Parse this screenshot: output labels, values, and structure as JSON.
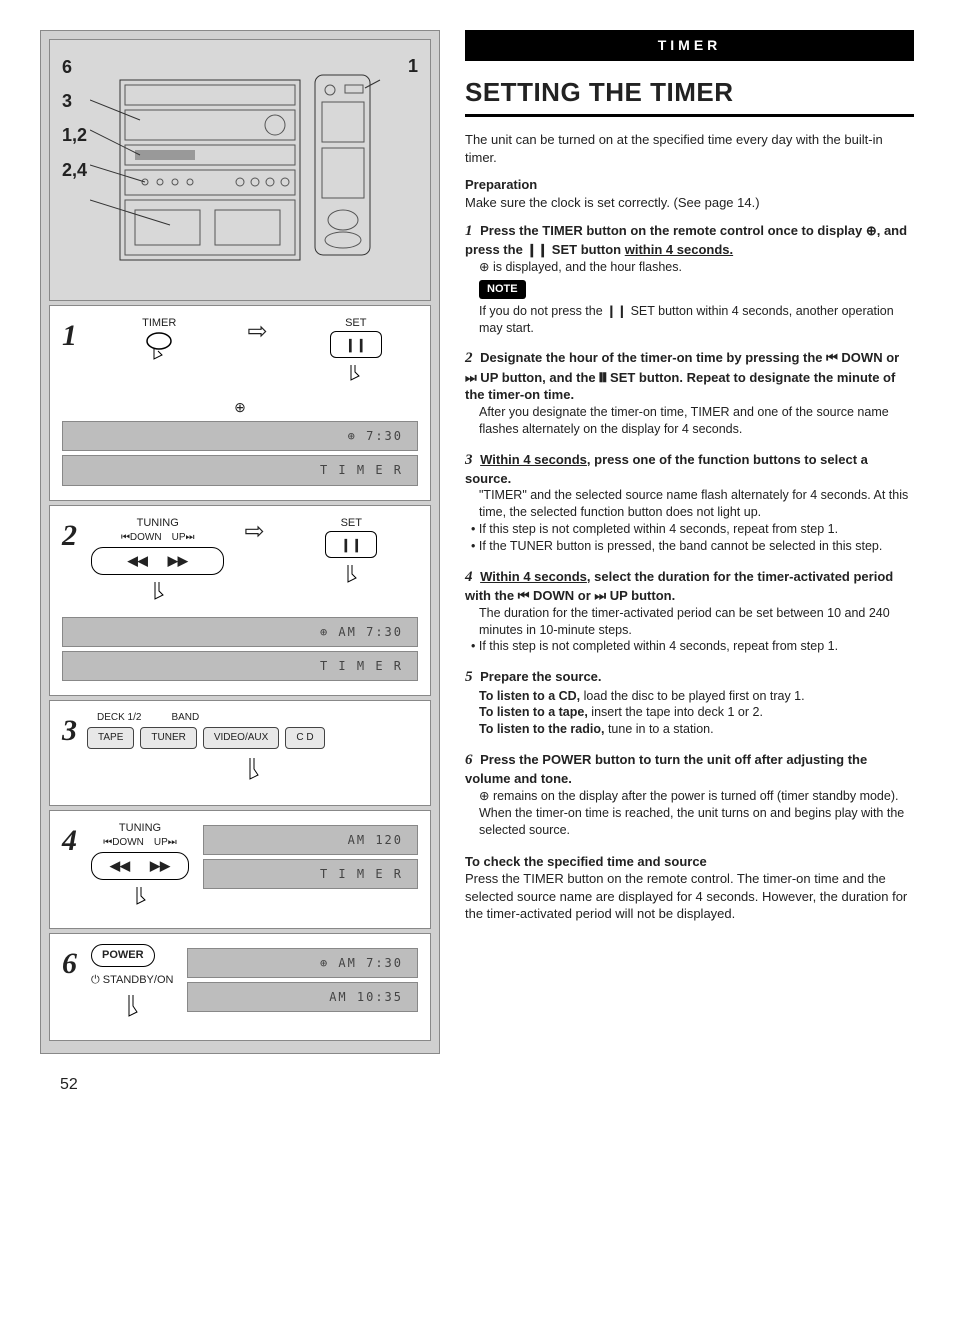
{
  "header": "TIMER",
  "title": "SETTING THE TIMER",
  "intro": "The unit can be turned on at the specified time every day with the built-in timer.",
  "prep_heading": "Preparation",
  "prep_text": "Make sure the clock is set correctly. (See page 14.)",
  "diagram_callouts": [
    "6",
    "3",
    "1,2",
    "2,4",
    "1"
  ],
  "steps_right": [
    {
      "num": "1",
      "bold": "Press the TIMER button on the remote control once to display ⊕, and press the ❙❙ SET button ",
      "bold_uline": "within 4 seconds.",
      "after": "⊕ is displayed, and the hour flashes.",
      "note_label": "NOTE",
      "note": "If you do not press the ❙❙ SET button within 4 seconds, another operation may start."
    },
    {
      "num": "2",
      "bold": "Designate the hour of the timer-on time by pressing the ⏮ DOWN or ⏭ UP button, and the ❙❙ SET button. Repeat to designate the minute of the timer-on time.",
      "after": "After you designate the timer-on time, TIMER and one of the source name flashes alternately on the display for 4 seconds."
    },
    {
      "num": "3",
      "bold_uline_lead": "Within 4 seconds",
      "bold_tail": ", press one of the function buttons to select a source.",
      "after": "\"TIMER\" and the selected source name flash alternately for 4 seconds. At this time, the selected function button does not light up.",
      "bullets": [
        "If this step is not completed within 4 seconds, repeat from step 1.",
        "If the TUNER button is pressed, the band cannot be selected in this step."
      ]
    },
    {
      "num": "4",
      "bold_uline_lead": "Within 4 seconds",
      "bold_tail": ", select the duration for the timer-activated period with the ⏮ DOWN or ⏭ UP button.",
      "after": "The duration for the timer-activated period can be set between 10 and 240 minutes in 10-minute steps.",
      "bullets": [
        "If this step is not completed within 4 seconds, repeat from step 1."
      ]
    },
    {
      "num": "5",
      "bold": "Prepare the source.",
      "lines": [
        {
          "b": "To listen to a CD,",
          "t": " load the disc to be played first on tray 1."
        },
        {
          "b": "To listen to a tape,",
          "t": " insert the tape into deck 1 or 2."
        },
        {
          "b": "To listen to the radio,",
          "t": " tune in to a station."
        }
      ]
    },
    {
      "num": "6",
      "bold": "Press the POWER button to turn the unit off after adjusting the volume and tone.",
      "after": "⊕ remains on the display after the power is turned off (timer standby mode).",
      "after2": "When the timer-on time is reached, the unit turns on and begins play with the selected source."
    }
  ],
  "check_heading": "To check the specified time and source",
  "check_text": "Press the TIMER button on the remote control. The timer-on time and the selected source name are displayed for 4 seconds. However, the duration for the timer-activated period will not be displayed.",
  "left_panels": {
    "p1": {
      "num": "1",
      "timer_label": "TIMER",
      "set_label": "SET",
      "pause": "❙❙",
      "disp1": "⊕  7:30",
      "disp2": "T I M E R"
    },
    "p2": {
      "num": "2",
      "tuning": "TUNING",
      "down": "⏮DOWN",
      "up": "UP⏭",
      "rew": "◀◀",
      "ff": "▶▶",
      "set_label": "SET",
      "pause": "❙❙",
      "disp1": "⊕ AM  7:30",
      "disp2": "T I M E R"
    },
    "p3": {
      "num": "3",
      "deck": "DECK 1/2",
      "band": "BAND",
      "b1": "TAPE",
      "b2": "TUNER",
      "b3": "VIDEO/AUX",
      "b4": "C D"
    },
    "p4": {
      "num": "4",
      "tuning": "TUNING",
      "down": "⏮DOWN",
      "up": "UP⏭",
      "rew": "◀◀",
      "ff": "▶▶",
      "disp1": "AM   120",
      "disp2": "T I M E R"
    },
    "p6": {
      "num": "6",
      "power": "POWER",
      "standby": "⏻ STANDBY/ON",
      "disp1": "⊕ AM   7:30",
      "disp2": "AM 10:35"
    }
  },
  "page_num": "52"
}
